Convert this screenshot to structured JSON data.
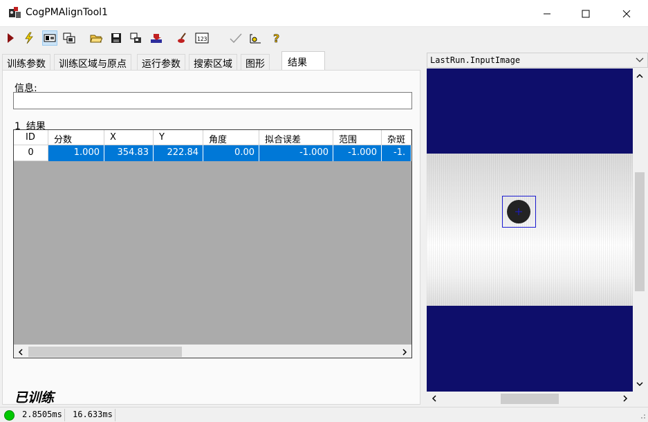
{
  "window": {
    "title": "CogPMAlignTool1",
    "controls": [
      "minimize-icon",
      "maximize-icon",
      "close-icon"
    ]
  },
  "toolbar": {
    "buttons": [
      "run-icon",
      "electric-icon",
      "display-icon",
      "floating-display-icon",
      "open-icon",
      "save-icon",
      "reset-icon",
      "import-icon",
      "terminal-icon",
      "counter-icon",
      "checkmark-icon",
      "tool-icon",
      "help-icon"
    ]
  },
  "tabs": [
    {
      "label": "训练参数"
    },
    {
      "label": "训练区域与原点"
    },
    {
      "label": "运行参数"
    },
    {
      "label": "搜索区域"
    },
    {
      "label": "图形"
    },
    {
      "label": "结果"
    }
  ],
  "active_tab": "结果",
  "results": {
    "info_label": "信息:",
    "info_value": "",
    "count": "1",
    "caption": "结果",
    "columns": [
      "ID",
      "分数",
      "X",
      "Y",
      "角度",
      "拟合误差",
      "范围",
      "杂斑"
    ],
    "rows": [
      {
        "id": "0",
        "score": "1.000",
        "x": "354.83",
        "y": "222.84",
        "angle": "0.00",
        "fit_error": "-1.000",
        "coverage": "-1.000",
        "clutter": "-1."
      }
    ]
  },
  "status_text": "已训练",
  "image_panel": {
    "selected_image": "LastRun.InputImage"
  },
  "statusbar": {
    "time1": "2.8505ms",
    "time2": "16.633ms"
  },
  "colors": {
    "selection": "#0078d7",
    "display_background": "#0e0e6b",
    "roi": "#1b1bd1",
    "led": "#00c800"
  }
}
